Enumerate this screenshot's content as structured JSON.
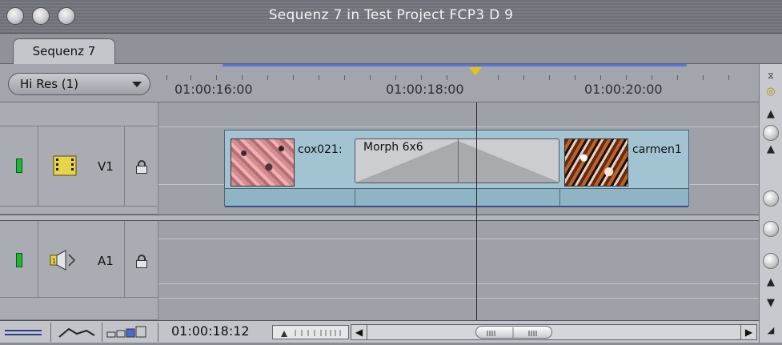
{
  "window": {
    "title": "Sequenz 7 in Test Project FCP3 D 9"
  },
  "tab": {
    "label": "Sequenz 7"
  },
  "resolution": {
    "label": "Hi Res (1)"
  },
  "ruler": {
    "timecodes": [
      "01:00:16:00",
      "01:00:18:00",
      "01:00:20:00"
    ]
  },
  "tracks": {
    "video": {
      "label": "V1",
      "icon": "film-icon"
    },
    "audio": {
      "label": "A1",
      "icon": "speaker-icon"
    }
  },
  "clips": [
    {
      "name": "cox021:"
    },
    {
      "name": "carmen1"
    }
  ],
  "transition": {
    "name": "Morph 6x6"
  },
  "footer": {
    "timecode": "01:00:18:12"
  },
  "colors": {
    "clip": "#a2c4d2",
    "track_on": "#1fb734",
    "playhead": "#e8c410",
    "range_bar": "#5a72d8"
  }
}
